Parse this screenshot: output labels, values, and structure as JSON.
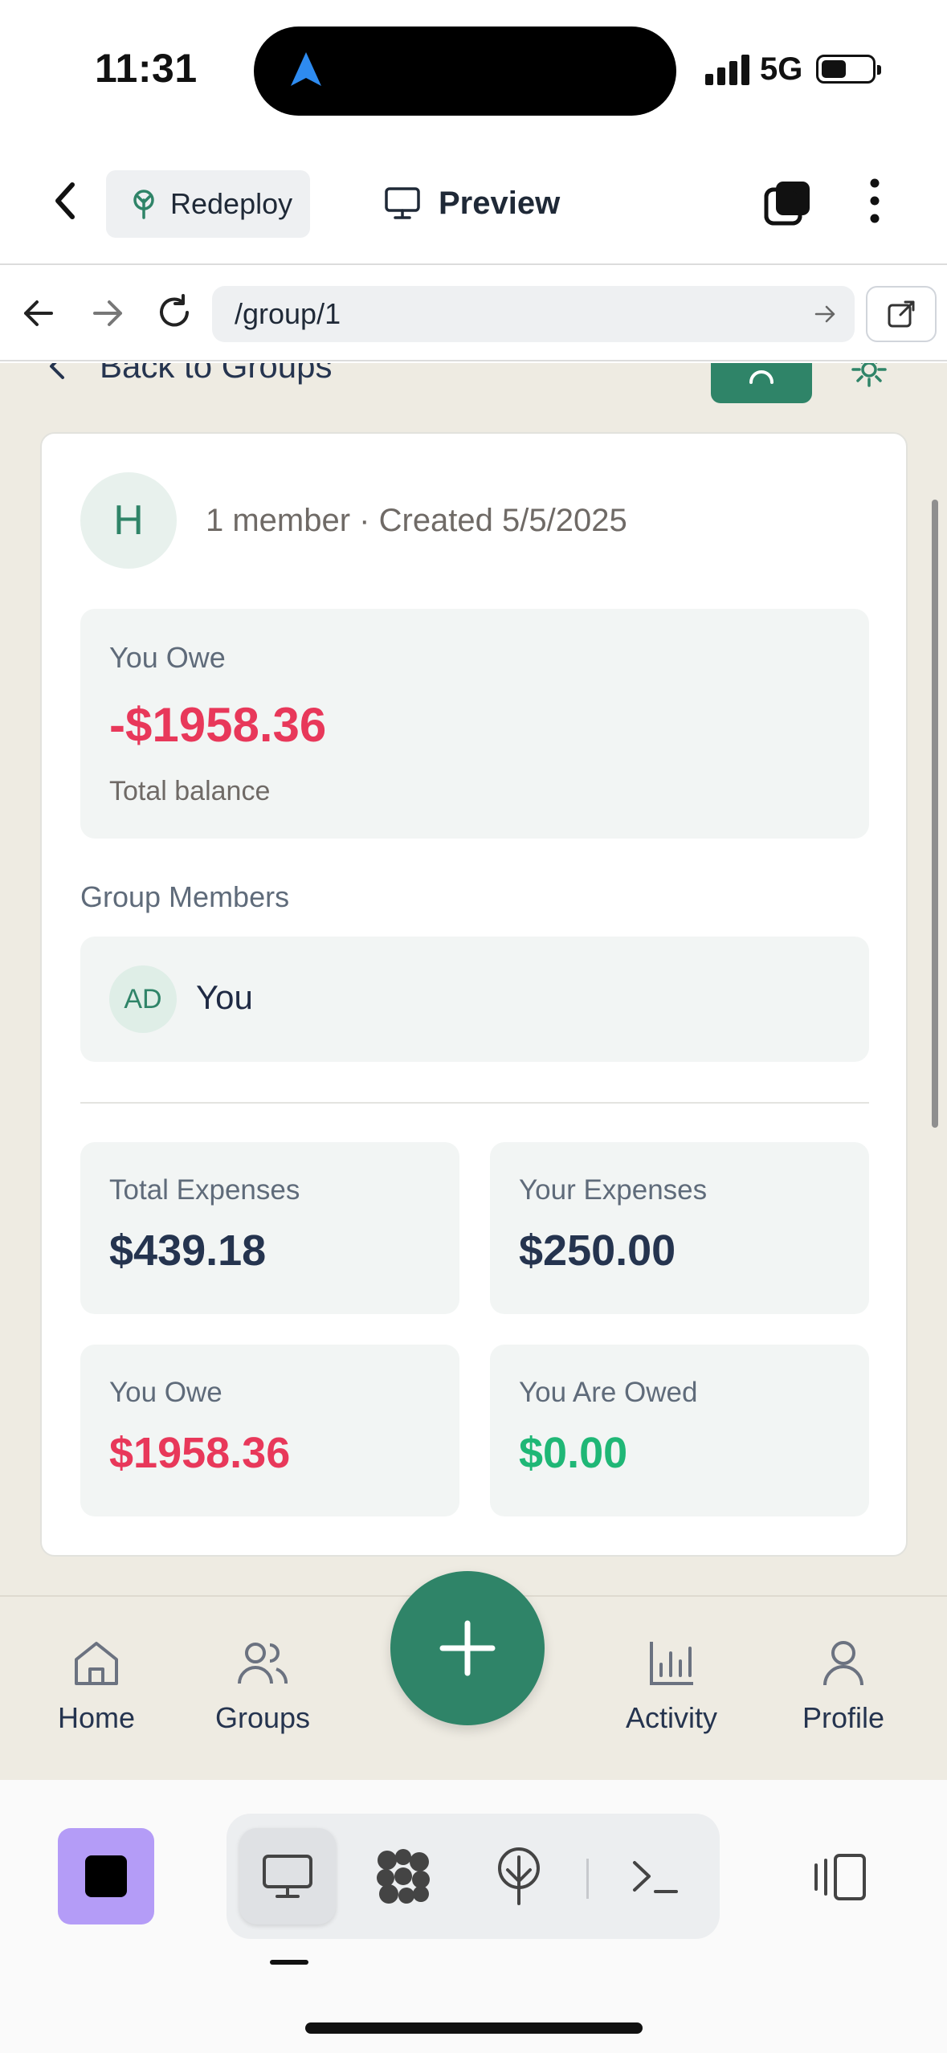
{
  "status_bar": {
    "time": "11:31",
    "network": "5G"
  },
  "header": {
    "redeploy_label": "Redeploy",
    "preview_label": "Preview"
  },
  "url_bar": {
    "url": "/group/1"
  },
  "group_page": {
    "back_label": "Back to Groups",
    "avatar_letter": "H",
    "meta": "1 member · Created 5/5/2025",
    "balance": {
      "label": "You Owe",
      "value": "-$1958.36",
      "sublabel": "Total balance"
    },
    "members_heading": "Group Members",
    "members": [
      {
        "initials": "AD",
        "name": "You"
      }
    ],
    "stats": [
      {
        "label": "Total Expenses",
        "value": "$439.18"
      },
      {
        "label": "Your Expenses",
        "value": "$250.00"
      },
      {
        "label": "You Owe",
        "value": "$1958.36"
      },
      {
        "label": "You Are Owed",
        "value": "$0.00"
      }
    ]
  },
  "tab_bar": {
    "items": [
      {
        "label": "Home",
        "icon": "home-icon"
      },
      {
        "label": "Groups",
        "icon": "users-icon"
      },
      {
        "label": "Activity",
        "icon": "bar-chart-icon"
      },
      {
        "label": "Profile",
        "icon": "user-icon"
      }
    ]
  },
  "colors": {
    "accent": "#2f8468",
    "negative": "#e8385a",
    "positive": "#1fb776",
    "background": "#eeebe2"
  }
}
